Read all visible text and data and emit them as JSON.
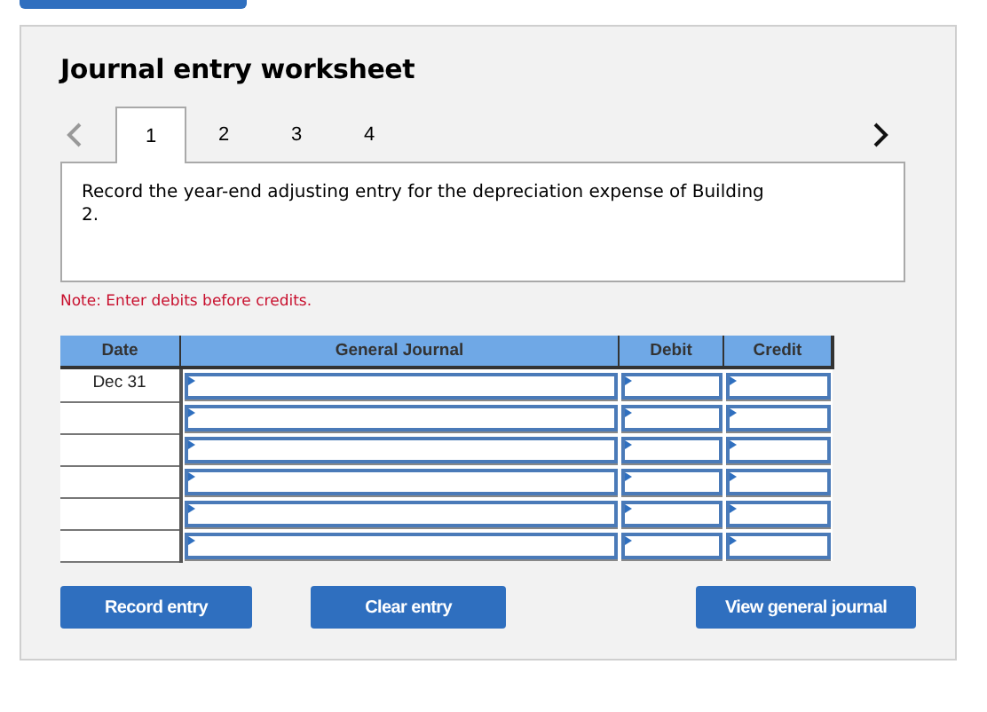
{
  "title": "Journal entry worksheet",
  "tabs": [
    {
      "label": "1",
      "selected": true
    },
    {
      "label": "2",
      "selected": false
    },
    {
      "label": "3",
      "selected": false
    },
    {
      "label": "4",
      "selected": false
    }
  ],
  "prompt": "Record the year-end adjusting entry for the depreciation expense of Building 2.",
  "note": "Note: Enter debits before credits.",
  "table": {
    "columns": [
      "Date",
      "General Journal",
      "Debit",
      "Credit"
    ],
    "rows": [
      {
        "date": "Dec 31"
      },
      {},
      {},
      {},
      {},
      {}
    ]
  },
  "buttons": [
    "Record entry",
    "Clear entry",
    "View general journal"
  ]
}
